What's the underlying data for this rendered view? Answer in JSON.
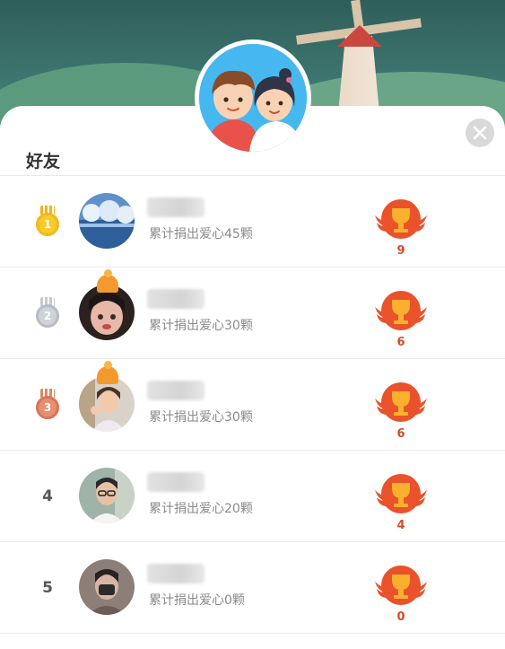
{
  "page": {
    "title": "好友"
  },
  "icons": {
    "close": "close-icon"
  },
  "friends": [
    {
      "rank": "1",
      "medal": "gold",
      "name": "■■■■■",
      "summary": "累计捐出爱心45颗",
      "trophies": "9"
    },
    {
      "rank": "2",
      "medal": "silver",
      "name": "■■■",
      "summary": "累计捐出爱心30颗",
      "trophies": "6"
    },
    {
      "rank": "3",
      "medal": "bronze",
      "name": "■■■",
      "summary": "累计捐出爱心30颗",
      "trophies": "6"
    },
    {
      "rank": "4",
      "medal": "",
      "name": "■■■",
      "summary": "累计捐出爱心20颗",
      "trophies": "4"
    },
    {
      "rank": "5",
      "medal": "",
      "name": "■■■",
      "summary": "累计捐出爱心0颗",
      "trophies": "0"
    }
  ],
  "colors": {
    "accent": "#e9522a",
    "gold": "#f5c21b",
    "silver": "#c9cdd3",
    "bronze": "#e0876a"
  }
}
